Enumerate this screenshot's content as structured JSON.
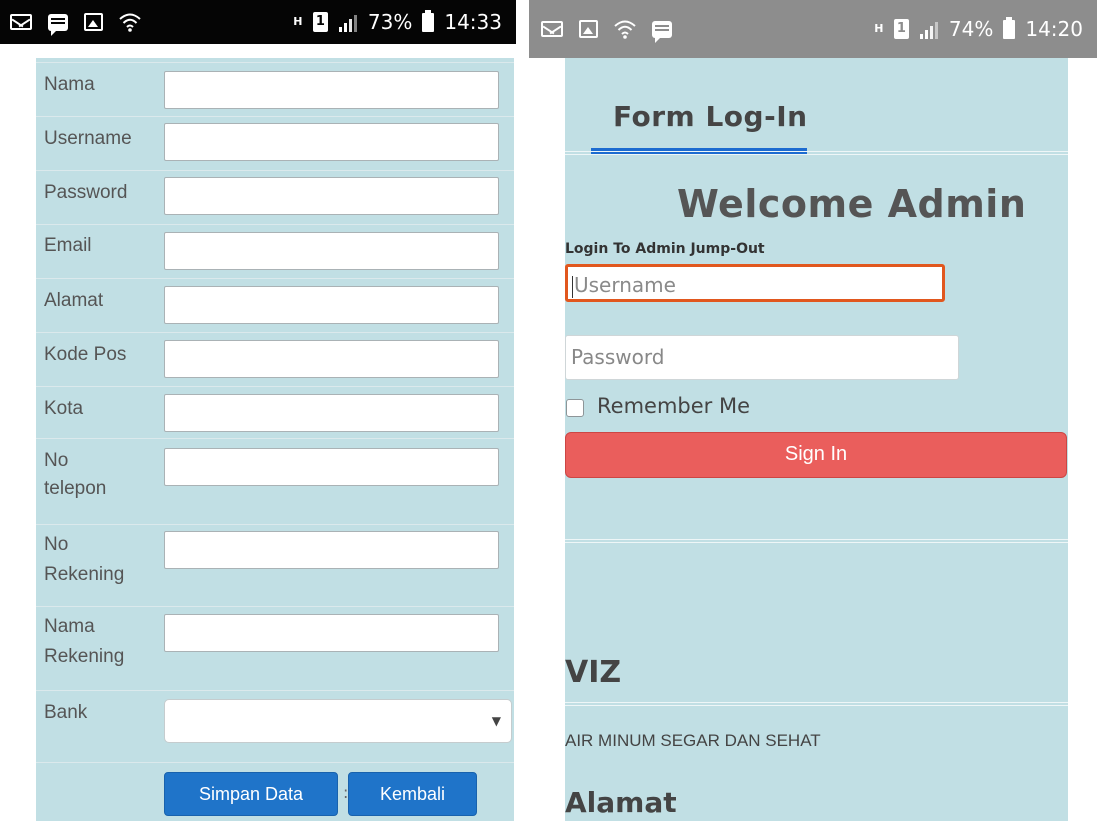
{
  "left_phone": {
    "status_bar": {
      "icons": [
        "mail-icon",
        "chat-icon",
        "gallery-icon",
        "wifi-icon"
      ],
      "network_type": "H",
      "sim_slot": "1",
      "battery_percent": "73%",
      "time": "14:33"
    },
    "form": {
      "fields": [
        {
          "label": "Nama",
          "value": ""
        },
        {
          "label": "Username",
          "value": ""
        },
        {
          "label": "Password",
          "value": ""
        },
        {
          "label": "Email",
          "value": ""
        },
        {
          "label": "Alamat",
          "value": ""
        },
        {
          "label": "Kode Pos",
          "value": ""
        },
        {
          "label": "Kota",
          "value": ""
        },
        {
          "label_line1": "No",
          "label_line2": "telepon",
          "value": ""
        },
        {
          "label_line1": "No",
          "label_line2": "Rekening",
          "value": ""
        },
        {
          "label_line1": "Nama",
          "label_line2": "Rekening",
          "value": ""
        }
      ],
      "bank": {
        "label": "Bank",
        "selected": ""
      },
      "save_button": "Simpan Data",
      "separator": ":",
      "back_button": "Kembali"
    }
  },
  "right_phone": {
    "status_bar": {
      "icons": [
        "mail-icon",
        "gallery-icon",
        "wifi-icon",
        "chat-icon"
      ],
      "network_type": "H",
      "sim_slot": "1",
      "battery_percent": "74%",
      "time": "14:20"
    },
    "login": {
      "panel_title": "Form Log-In",
      "welcome": "Welcome Admin",
      "subtitle": "Login To Admin Jump-Out",
      "username_placeholder": "Username",
      "password_placeholder": "Password",
      "remember_label": "Remember Me",
      "sign_in_button": "Sign In"
    },
    "footer": {
      "brand": "VIZ",
      "slogan": "AIR MINUM SEGAR DAN SEHAT",
      "address_heading": "Alamat"
    }
  },
  "colors": {
    "panel_bg": "#c1dfe4",
    "primary_blue": "#1f74c9",
    "sign_in_red": "#ea5e5c",
    "focus_orange": "#e1571e",
    "underline_blue": "#1c6bd0"
  }
}
